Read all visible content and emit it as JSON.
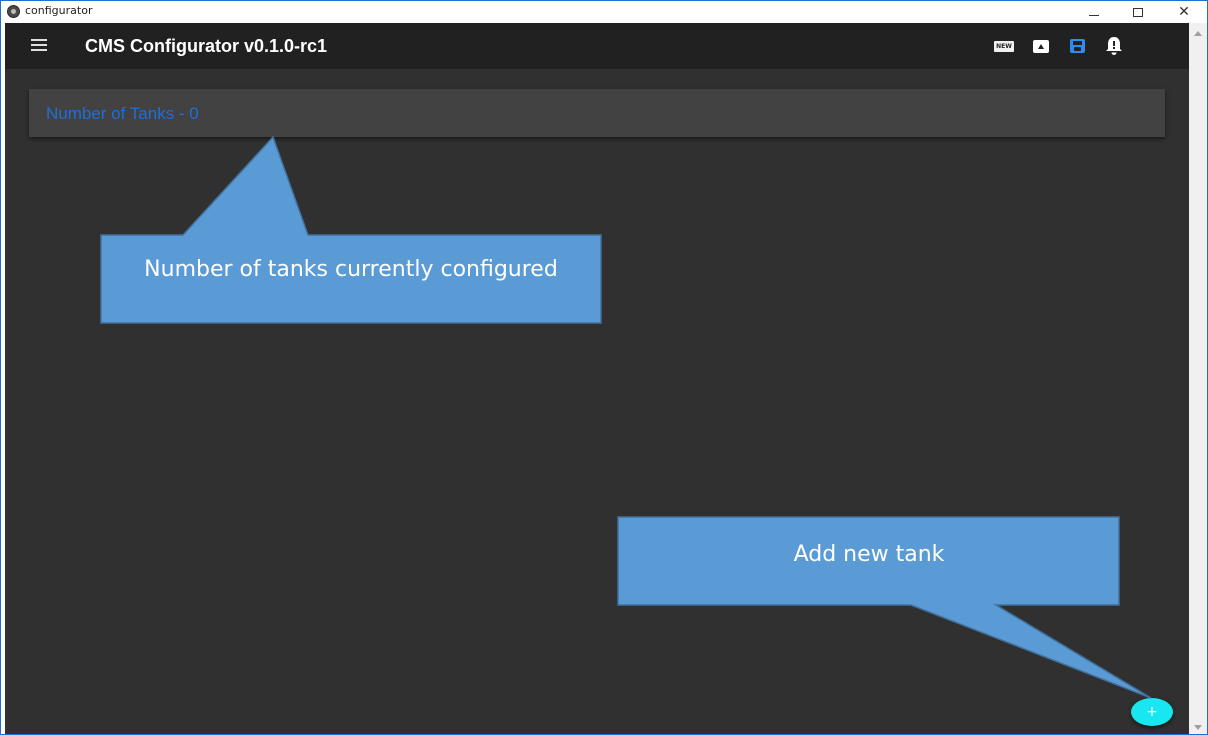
{
  "window": {
    "title": "configurator",
    "close_glyph": "✕"
  },
  "appbar": {
    "title": "CMS Configurator v0.1.0-rc1",
    "icons": {
      "menu": "hamburger-menu-icon",
      "new": "new-file-icon",
      "new_label": "NEW",
      "open": "open-folder-icon",
      "save": "save-icon",
      "notifications": "notification-bell-icon"
    },
    "colors": {
      "background": "#212121",
      "save_accent": "#2d8cf0"
    }
  },
  "tanks": {
    "summary_label": "Number of Tanks - 0",
    "color": "#1e6fd9"
  },
  "fab": {
    "label": "+",
    "color": "#18e6f0"
  },
  "annotations": {
    "tanks_callout": "Number of tanks currently configured",
    "add_callout": "Add new tank",
    "fill": "#5b9bd5",
    "stroke": "#41719c"
  }
}
